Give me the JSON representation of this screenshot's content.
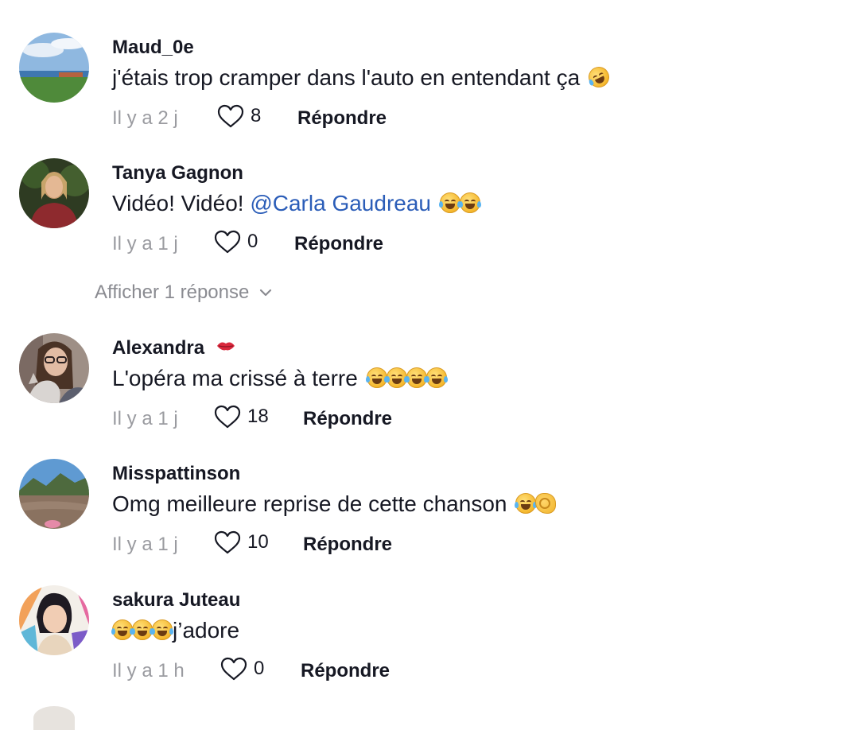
{
  "comments": [
    {
      "username": "Maud_0e",
      "text": "j'étais trop cramper dans l'auto en entendant ça",
      "time": "Il y a 2 j",
      "likes": "8",
      "reply": "Répondre",
      "emoji_icons": [
        "rolling-on-floor-laughing-icon"
      ]
    },
    {
      "username": "Tanya Gagnon",
      "text": "Vidéo! Vidéo! ",
      "mention": "@Carla Gaudreau",
      "time": "Il y a 1 j",
      "likes": "0",
      "reply": "Répondre",
      "emoji_icons": [
        "tears-of-joy-icon",
        "tears-of-joy-icon"
      ]
    },
    {
      "username": "Alexandra",
      "text": "L'opéra ma crissé à terre",
      "time": "Il y a 1 j",
      "likes": "18",
      "reply": "Répondre",
      "emoji_icons": [
        "tears-of-joy-icon",
        "tears-of-joy-icon",
        "tears-of-joy-icon",
        "tears-of-joy-icon"
      ],
      "badge_icon": "lips-icon"
    },
    {
      "username": "Misspattinson",
      "text": "Omg meilleure reprise de cette chanson",
      "time": "Il y a 1 j",
      "likes": "10",
      "reply": "Répondre",
      "emoji_icons": [
        "tears-of-joy-icon",
        "ok-hand-icon"
      ]
    },
    {
      "username": "sakura Juteau",
      "text": "j’adore",
      "time": "Il y a 1 h",
      "likes": "0",
      "reply": "Répondre",
      "emoji_icons": [
        "tears-of-joy-icon",
        "tears-of-joy-icon",
        "tears-of-joy-icon"
      ]
    }
  ],
  "show_replies": {
    "label": "Afficher 1 réponse",
    "icon": "chevron-down-icon"
  },
  "colors": {
    "text": "#161823",
    "muted": "#9a9ba0",
    "mention": "#2b5db8",
    "background": "#ffffff"
  }
}
